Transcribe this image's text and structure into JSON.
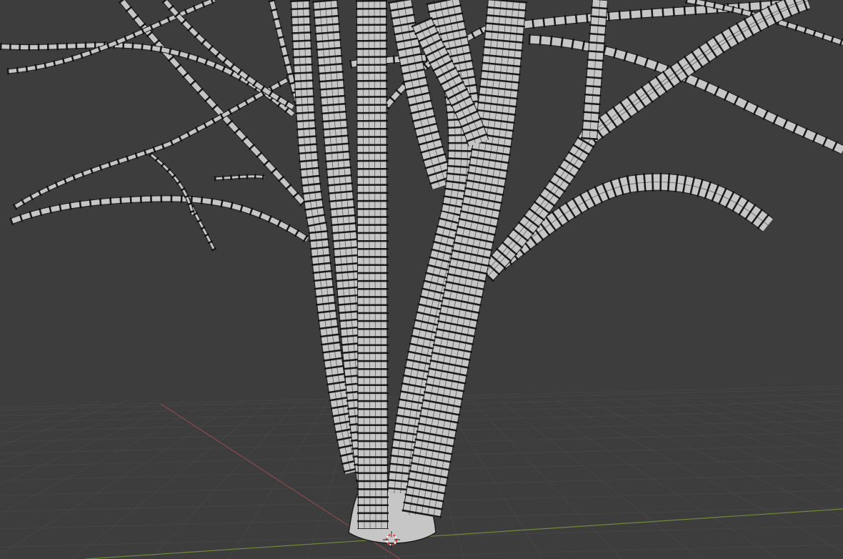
{
  "viewport": {
    "mode": "edit-mode-wireframe-overlay",
    "object": "tree-mesh"
  },
  "colors": {
    "background": "#3d3d3d",
    "grid": "#474747",
    "x_axis": "#8a4a52",
    "y_axis": "#6e8a3a",
    "mesh_face": "#c6c6c6",
    "mesh_edge": "#1c1c1c",
    "vertex": "#111111"
  },
  "icons": [
    "3d-cursor-icon"
  ]
}
